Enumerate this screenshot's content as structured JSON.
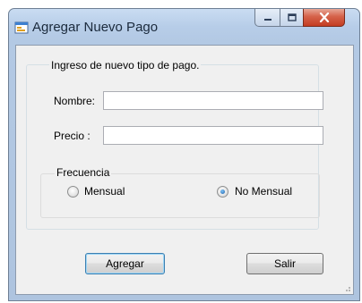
{
  "window": {
    "title": "Agregar Nuevo Pago"
  },
  "group": {
    "legend": "Ingreso de nuevo tipo de pago."
  },
  "form": {
    "nombre_label": "Nombre:",
    "nombre_value": "",
    "precio_label": "Precio :",
    "precio_value": ""
  },
  "frequency": {
    "legend": "Frecuencia",
    "options": [
      {
        "label": "Mensual",
        "selected": false
      },
      {
        "label": "No Mensual",
        "selected": true
      }
    ]
  },
  "buttons": {
    "add": "Agregar",
    "exit": "Salir"
  },
  "icons": {
    "app": "window-form-icon",
    "minimize": "minimize-icon",
    "maximize": "maximize-icon",
    "close": "close-icon",
    "grip": "resize-grip-icon"
  },
  "colors": {
    "selected_radio": "#1c5fa8",
    "close_button": "#c43d22"
  }
}
